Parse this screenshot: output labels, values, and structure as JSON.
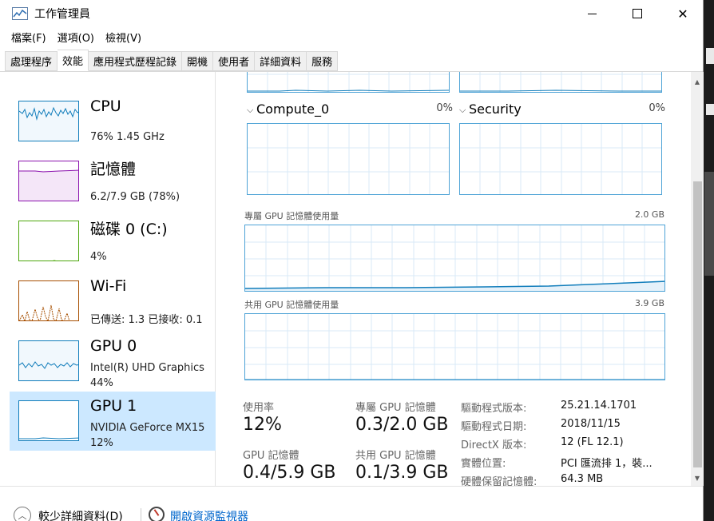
{
  "window": {
    "title": "工作管理員"
  },
  "menu": [
    "檔案(F)",
    "選項(O)",
    "檢視(V)"
  ],
  "tabs": [
    {
      "label": "處理程序",
      "active": false
    },
    {
      "label": "效能",
      "active": true
    },
    {
      "label": "應用程式歷程記錄",
      "active": false
    },
    {
      "label": "開機",
      "active": false
    },
    {
      "label": "使用者",
      "active": false
    },
    {
      "label": "詳細資料",
      "active": false
    },
    {
      "label": "服務",
      "active": false
    }
  ],
  "sidebar": {
    "items": [
      {
        "name": "CPU",
        "line1": "76% 1.45 GHz",
        "line2": "",
        "color": "#117dbb"
      },
      {
        "name": "記憶體",
        "line1": "6.2/7.9 GB (78%)",
        "line2": "",
        "color": "#8b12ae"
      },
      {
        "name": "磁碟 0 (C:)",
        "line1": "4%",
        "line2": "",
        "color": "#4da60c"
      },
      {
        "name": "Wi-Fi",
        "line1": "已傳送: 1.3  已接收: 0.1",
        "line2": "",
        "color": "#a74f01"
      },
      {
        "name": "GPU 0",
        "line1": "Intel(R) UHD Graphics",
        "line2": "44%",
        "color": "#117dbb"
      },
      {
        "name": "GPU 1",
        "line1": "NVIDIA GeForce MX15",
        "line2": "12%",
        "color": "#117dbb",
        "selected": true
      }
    ]
  },
  "engines": [
    {
      "name": "Compute_0",
      "pct": "0%"
    },
    {
      "name": "Security",
      "pct": "0%"
    }
  ],
  "memory_graphs": {
    "dedicated": {
      "label": "專屬 GPU 記憶體使用量",
      "max": "2.0 GB"
    },
    "shared": {
      "label": "共用 GPU 記憶體使用量",
      "max": "3.9 GB"
    }
  },
  "stats": {
    "usage": {
      "label": "使用率",
      "value": "12%"
    },
    "dedicated": {
      "label": "專屬 GPU 記憶體",
      "value": "0.3/2.0 GB"
    },
    "gpu_mem": {
      "label": "GPU 記憶體",
      "value": "0.4/5.9 GB"
    },
    "shared": {
      "label": "共用 GPU 記憶體",
      "value": "0.1/3.9 GB"
    }
  },
  "info": [
    {
      "label": "驅動程式版本:",
      "value": "25.21.14.1701"
    },
    {
      "label": "驅動程式日期:",
      "value": "2018/11/15"
    },
    {
      "label": "DirectX 版本:",
      "value": "12 (FL 12.1)"
    },
    {
      "label": "實體位置:",
      "value": "PCI 匯流排 1，裝..."
    },
    {
      "label": "硬體保留記憶體:",
      "value": "64.3 MB"
    }
  ],
  "footer": {
    "fewer_details": "較少詳細資料(D)",
    "open_monitor": "開啟資源監視器"
  }
}
